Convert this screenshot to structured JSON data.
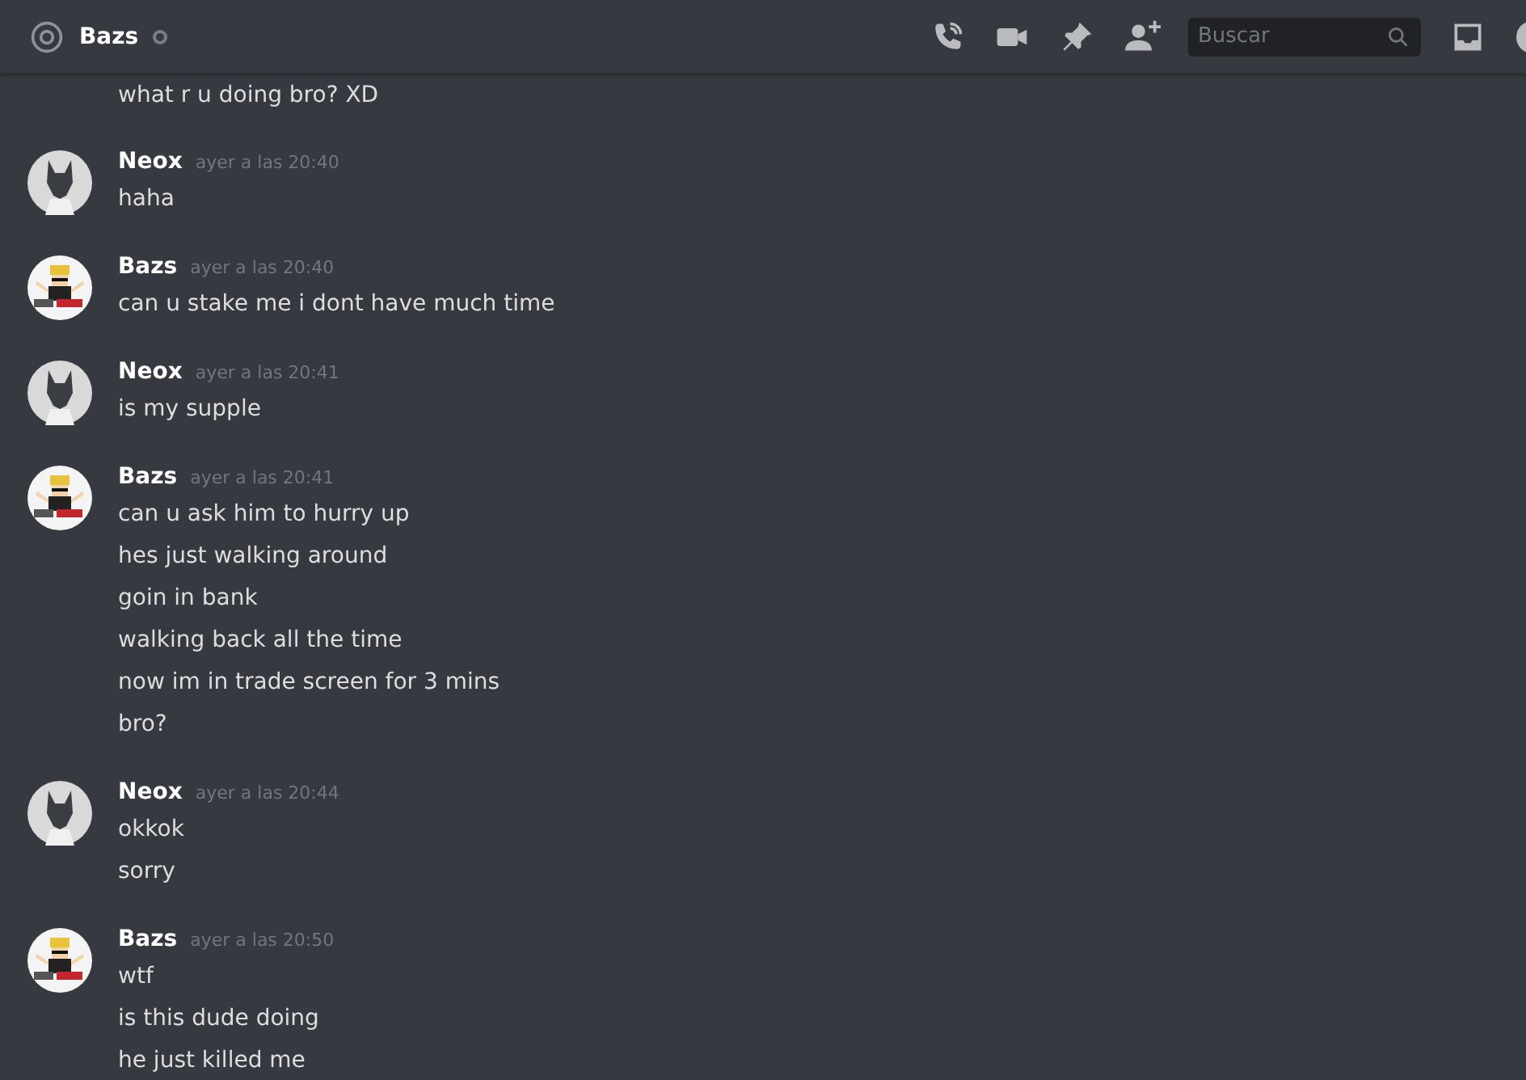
{
  "header": {
    "title": "Bazs",
    "search": {
      "placeholder": "Buscar"
    }
  },
  "top_line": "what r u doing bro? XD",
  "messages": [
    {
      "author": "Neox",
      "kind": "wolf",
      "time": "ayer a las 20:40",
      "lines": [
        "haha"
      ]
    },
    {
      "author": "Bazs",
      "kind": "figure",
      "time": "ayer a las 20:40",
      "lines": [
        "can u stake me i dont have much time"
      ]
    },
    {
      "author": "Neox",
      "kind": "wolf",
      "time": "ayer a las 20:41",
      "lines": [
        "is my supple"
      ]
    },
    {
      "author": "Bazs",
      "kind": "figure",
      "time": "ayer a las 20:41",
      "lines": [
        "can u ask him to hurry up",
        "hes just walking around",
        "goin in bank",
        "walking back all the time",
        "now im in trade screen for 3 mins",
        "bro?"
      ]
    },
    {
      "author": "Neox",
      "kind": "wolf",
      "time": "ayer a las 20:44",
      "lines": [
        "okkok",
        "sorry"
      ]
    },
    {
      "author": "Bazs",
      "kind": "figure",
      "time": "ayer a las 20:50",
      "lines": [
        "wtf",
        "is this dude doing",
        "he just killed me"
      ]
    }
  ]
}
